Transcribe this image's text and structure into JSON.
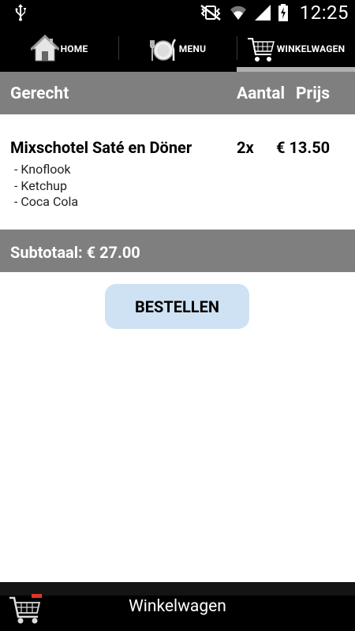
{
  "status_bar": {
    "time": "12:25",
    "icons": [
      "usb-icon",
      "vibrate-mute-icon",
      "wifi-icon",
      "signal-icon",
      "battery-icon"
    ]
  },
  "tabs": [
    {
      "label": "HOME",
      "icon": "home-icon",
      "active": false
    },
    {
      "label": "MENU",
      "icon": "plate-cutlery-icon",
      "active": false
    },
    {
      "label": "WINKELWAGEN",
      "icon": "shopping-cart-icon",
      "active": true
    }
  ],
  "table_header": {
    "dish": "Gerecht",
    "quantity": "Aantal",
    "price": "Prijs"
  },
  "cart_items": [
    {
      "name": "Mixschotel Saté en Döner",
      "quantity": "2x",
      "price": "€ 13.50",
      "extras": [
        "- Knoflook",
        "- Ketchup",
        "- Coca Cola"
      ]
    }
  ],
  "subtotal_label": "Subtotaal: € 27.00",
  "order_button": "BESTELLEN",
  "bottom_bar": {
    "title": "Winkelwagen",
    "icon": "shopping-cart-icon"
  },
  "colors": {
    "header_gray": "#7f7f7f",
    "button_blue": "#cfe2f3",
    "active_tab_indicator": "#b0b0b0"
  }
}
